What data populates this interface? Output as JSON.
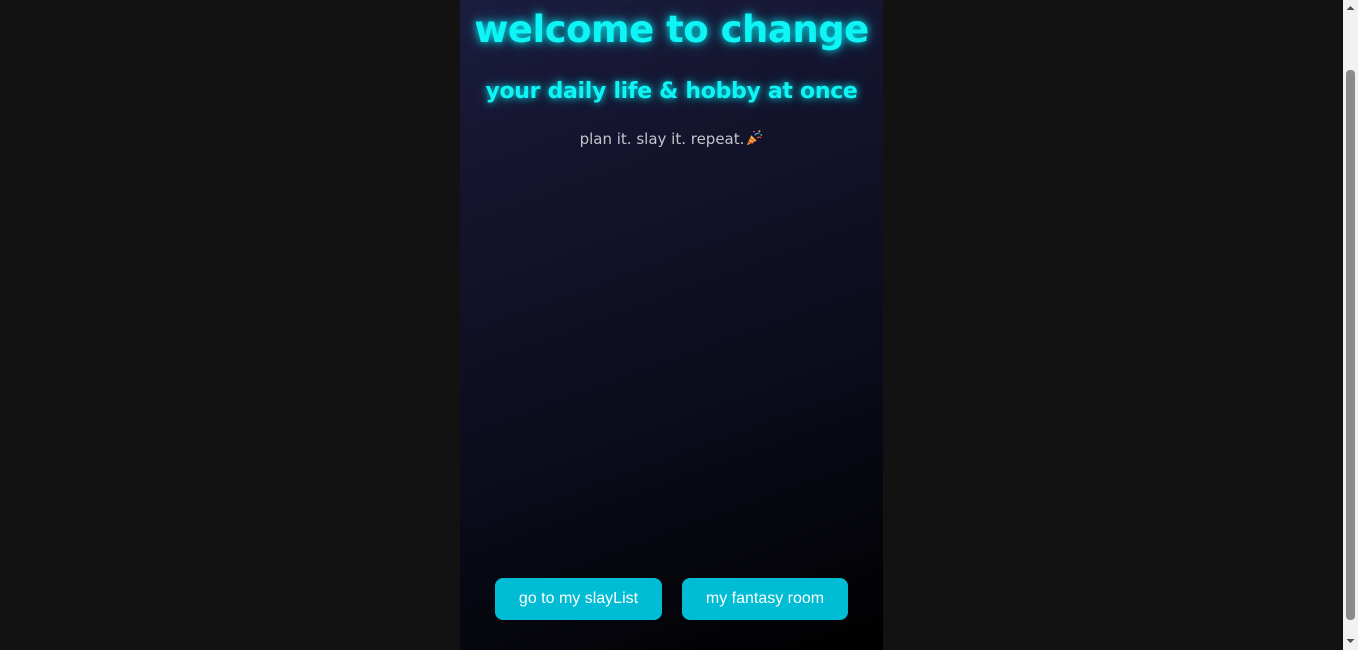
{
  "page": {
    "title": "welcome to change",
    "subtitle": "your daily life & hobby at once",
    "tagline": "plan it. slay it. repeat.",
    "tagline_icon": "party-popper-icon"
  },
  "buttons": {
    "slaylist_label": "go to my slayList",
    "fantasy_label": "my fantasy room"
  },
  "colors": {
    "accent_glow": "#0ff4f4",
    "button_bg": "#00bcd4",
    "page_bg": "#121212",
    "panel_top": "#1c1c3e",
    "panel_bottom": "#000000"
  }
}
